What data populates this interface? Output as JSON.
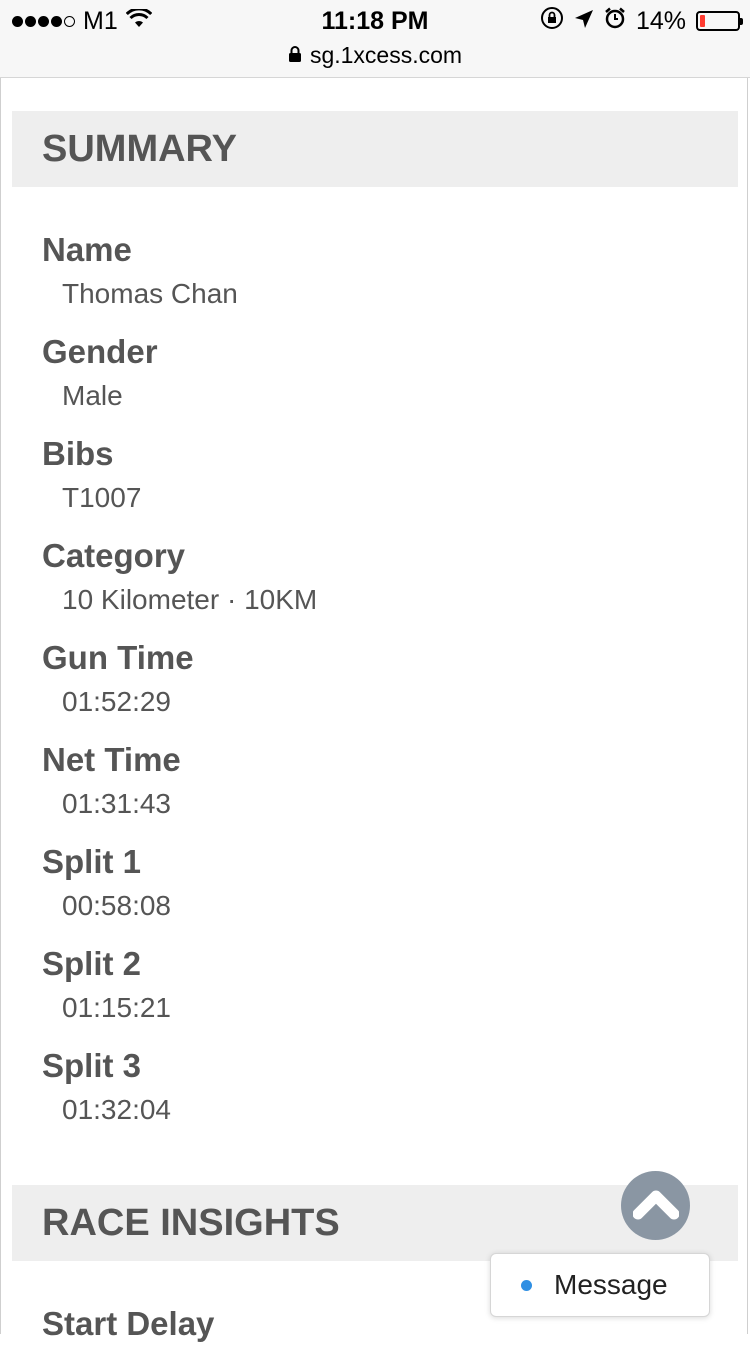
{
  "status_bar": {
    "carrier": "M1",
    "time": "11:18 PM",
    "battery_percent": "14%",
    "battery_level": 0.14,
    "battery_color": "#ff3b30",
    "signal_icons": [
      "signal-dots-icon",
      "wifi-icon"
    ],
    "right_icons": [
      "orientation-lock-icon",
      "location-arrow-icon",
      "alarm-icon",
      "battery-icon"
    ]
  },
  "browser": {
    "url": "sg.1xcess.com",
    "lock_icon": "lock-icon"
  },
  "summary": {
    "title": "SUMMARY",
    "fields": [
      {
        "label": "Name",
        "value": "Thomas Chan"
      },
      {
        "label": "Gender",
        "value": "Male"
      },
      {
        "label": "Bibs",
        "value": "T1007"
      },
      {
        "label": "Category",
        "value": "10 Kilometer · 10KM"
      },
      {
        "label": "Gun Time",
        "value": "01:52:29"
      },
      {
        "label": "Net Time",
        "value": "01:31:43"
      },
      {
        "label": "Split 1",
        "value": "00:58:08"
      },
      {
        "label": "Split 2",
        "value": "01:15:21"
      },
      {
        "label": "Split 3",
        "value": "01:32:04"
      }
    ]
  },
  "race_insights": {
    "title": "RACE INSIGHTS",
    "first_label": "Start Delay"
  },
  "floating": {
    "scroll_top_icon": "chevron-up-icon",
    "message_label": "Message",
    "message_dot_color": "#2f8fe3"
  },
  "colors": {
    "text_gray": "#555555",
    "header_bg": "#eeeeee",
    "scroll_button_bg": "#8a96a3"
  }
}
